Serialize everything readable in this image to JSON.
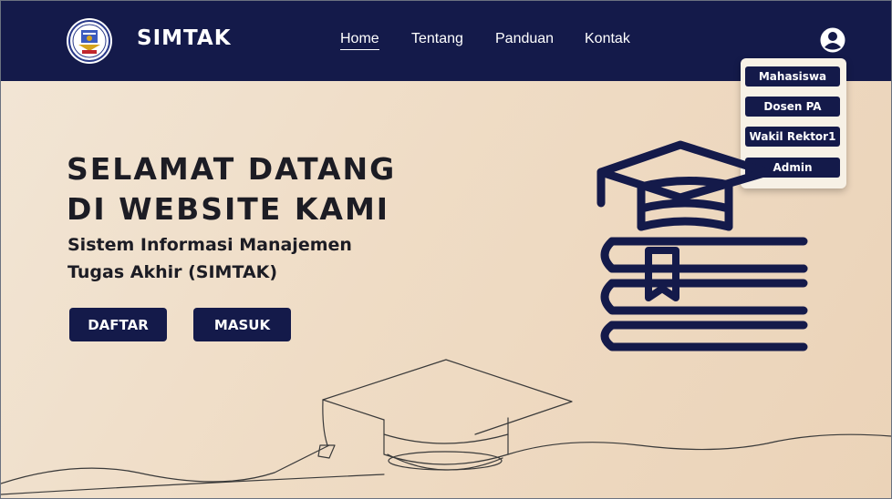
{
  "navbar": {
    "brand": "SIMTAK",
    "links": [
      {
        "label": "Home",
        "active": true
      },
      {
        "label": "Tentang",
        "active": false
      },
      {
        "label": "Panduan",
        "active": false
      },
      {
        "label": "Kontak",
        "active": false
      }
    ],
    "user_icon": "user-circle-icon"
  },
  "dropdown": {
    "items": [
      "Mahasiswa",
      "Dosen PA",
      "Wakil Rektor1",
      "Admin"
    ]
  },
  "hero": {
    "title_line1": "SELAMAT DATANG",
    "title_line2": "DI WEBSITE KAMI",
    "subtitle_line1": "Sistem Informasi Manajemen",
    "subtitle_line2": "Tugas Akhir (SIMTAK)",
    "buttons": {
      "register": "DAFTAR",
      "login": "MASUK"
    }
  },
  "icons": {
    "logo": "university-emblem-icon",
    "illustration": "graduation-cap-books-icon",
    "line_art": "graduation-cap-line-art"
  },
  "colors": {
    "navy": "#141a4a",
    "background": "#efdcc5",
    "text": "#1c1c24",
    "white": "#ffffff"
  }
}
